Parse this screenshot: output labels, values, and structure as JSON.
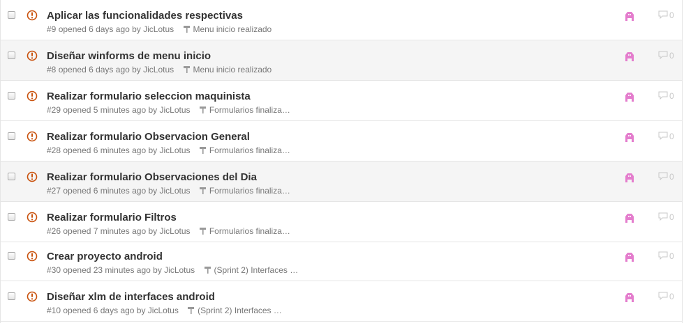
{
  "issues": [
    {
      "title": "Aplicar las funcionalidades respectivas",
      "number": "#9",
      "meta": "opened 6 days ago by JicLotus",
      "milestone": "Menu inicio realizado",
      "comments": "0"
    },
    {
      "title": "Diseñar winforms de menu inicio",
      "number": "#8",
      "meta": "opened 6 days ago by JicLotus",
      "milestone": "Menu inicio realizado",
      "comments": "0"
    },
    {
      "title": "Realizar formulario seleccion maquinista",
      "number": "#29",
      "meta": "opened 5 minutes ago by JicLotus",
      "milestone": "Formularios finaliza…",
      "comments": "0"
    },
    {
      "title": "Realizar formulario Observacion General",
      "number": "#28",
      "meta": "opened 6 minutes ago by JicLotus",
      "milestone": "Formularios finaliza…",
      "comments": "0"
    },
    {
      "title": "Realizar formulario Observaciones del Dia",
      "number": "#27",
      "meta": "opened 6 minutes ago by JicLotus",
      "milestone": "Formularios finaliza…",
      "comments": "0"
    },
    {
      "title": "Realizar formulario Filtros",
      "number": "#26",
      "meta": "opened 7 minutes ago by JicLotus",
      "milestone": "Formularios finaliza…",
      "comments": "0"
    },
    {
      "title": "Crear proyecto android",
      "number": "#30",
      "meta": "opened 23 minutes ago by JicLotus",
      "milestone": "(Sprint 2) Interfaces …",
      "comments": "0"
    },
    {
      "title": "Diseñar xlm de interfaces android",
      "number": "#10",
      "meta": "opened 6 days ago by JicLotus",
      "milestone": "(Sprint 2) Interfaces …",
      "comments": "0"
    }
  ],
  "colors": {
    "open_icon": "#c9510c",
    "label_icon": "#e47dcd",
    "row_alt": "#f5f5f5"
  },
  "icons": {
    "state": "issue-opened-icon",
    "milestone": "milestone-icon",
    "label": "label-icon",
    "comment": "comment-icon"
  }
}
